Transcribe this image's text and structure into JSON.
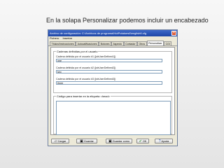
{
  "caption": "En la solapa Personalizar podemos incluir un encabezado",
  "window": {
    "title": "Archivo de configuración: C:\\Archivos de programa\\HotPotatoes6\\english6.cfg",
    "close_glyph": "✕"
  },
  "menu": [
    "Fichero",
    "Insertar"
  ],
  "tabs": [
    "Títulos/Instrucciones",
    "Autocalificaciones",
    "Botones",
    "Aspecto",
    "Contador",
    "Otros",
    "Personalizar",
    "CGI"
  ],
  "custom_strings": {
    "title": "Cadenas definidas por el usuario",
    "fields": [
      {
        "label": "Cadena definida por el usuario #1 ([strUserDefined1])",
        "value": "one"
      },
      {
        "label": "Cadena definida por el usuario #2 ([strUserDefined2])",
        "value": "two"
      },
      {
        "label": "Cadena definida por el usuario #3 ([strUserDefined3])",
        "value": "three"
      }
    ]
  },
  "head_code": {
    "title": "Código para insertar en la etiqueta <head>"
  },
  "buttons": [
    {
      "label": "Cargar",
      "icon": "folder-icon"
    },
    {
      "label": "Guardar",
      "icon": "save-icon"
    },
    {
      "label": "Guardar como",
      "icon": "save-as-icon"
    },
    {
      "label": "OK",
      "icon": "check-icon"
    },
    {
      "label": "Ayuda",
      "icon": "help-icon"
    }
  ]
}
